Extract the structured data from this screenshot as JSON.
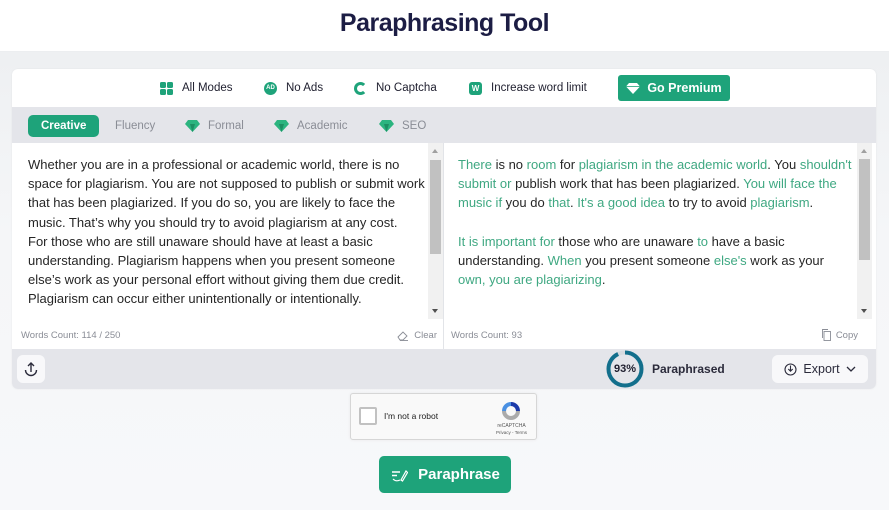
{
  "header": {
    "title": "Paraphrasing Tool"
  },
  "features": [
    {
      "icon": "grid-icon",
      "label": "All Modes"
    },
    {
      "icon": "no-ads-icon",
      "label": "No Ads"
    },
    {
      "icon": "no-captcha-icon",
      "label": "No Captcha"
    },
    {
      "icon": "word-limit-icon",
      "label": "Increase word limit"
    }
  ],
  "premium": {
    "label": "Go Premium",
    "icon": "diamond-icon"
  },
  "modes": [
    {
      "label": "Creative",
      "active": true,
      "premium": false
    },
    {
      "label": "Fluency",
      "active": false,
      "premium": false
    },
    {
      "label": "Formal",
      "active": false,
      "premium": true
    },
    {
      "label": "Academic",
      "active": false,
      "premium": true
    },
    {
      "label": "SEO",
      "active": false,
      "premium": true
    }
  ],
  "input": {
    "paragraphs": [
      "Whether you are in a professional or academic world, there is no space for plagiarism. You are not supposed to publish or submit work that has been plagiarized. If you do so, you are likely to face the music. That’s why you should try to avoid plagiarism at any cost.",
      "For those who are still unaware should have at least a basic understanding. Plagiarism happens when you present someone else’s work as your personal effort without giving them due credit. Plagiarism can occur either unintentionally or intentionally."
    ],
    "word_count": "Words Count: 114 / 250",
    "clear_label": "Clear"
  },
  "output": {
    "paragraphs": [
      [
        {
          "t": "There",
          "h": true
        },
        {
          "t": " is no ",
          "h": false
        },
        {
          "t": "room",
          "h": true
        },
        {
          "t": " for ",
          "h": false
        },
        {
          "t": "plagiarism in the academic world",
          "h": true
        },
        {
          "t": ". You ",
          "h": false
        },
        {
          "t": "shouldn't submit or",
          "h": true
        },
        {
          "t": " publish work that has been plagiarized. ",
          "h": false
        },
        {
          "t": "You will face the music if",
          "h": true
        },
        {
          "t": " you do ",
          "h": false
        },
        {
          "t": "that",
          "h": true
        },
        {
          "t": ". ",
          "h": false
        },
        {
          "t": "It's a good idea",
          "h": true
        },
        {
          "t": " to try to avoid ",
          "h": false
        },
        {
          "t": "plagiarism",
          "h": true
        },
        {
          "t": ".",
          "h": false
        }
      ],
      [
        {
          "t": "It is important for",
          "h": true
        },
        {
          "t": " those who are unaware ",
          "h": false
        },
        {
          "t": "to",
          "h": true
        },
        {
          "t": " have a basic understanding. ",
          "h": false
        },
        {
          "t": "When",
          "h": true
        },
        {
          "t": " you present someone ",
          "h": false
        },
        {
          "t": "else's",
          "h": true
        },
        {
          "t": " work as your ",
          "h": false
        },
        {
          "t": "own, you are plagiarizing",
          "h": true
        },
        {
          "t": ".",
          "h": false
        }
      ]
    ],
    "word_count": "Words Count: 93",
    "copy_label": "Copy"
  },
  "status": {
    "percent": 93,
    "percent_label": "93%",
    "label": "Paraphrased",
    "export_label": "Export"
  },
  "captcha": {
    "label": "I'm not a robot",
    "brand": "reCAPTCHA",
    "terms": "Privacy - Terms"
  },
  "action": {
    "label": "Paraphrase"
  },
  "colors": {
    "accent": "#1ea37a",
    "highlight": "#3fa882",
    "ring": "#136f8c",
    "title": "#1c1d44"
  }
}
